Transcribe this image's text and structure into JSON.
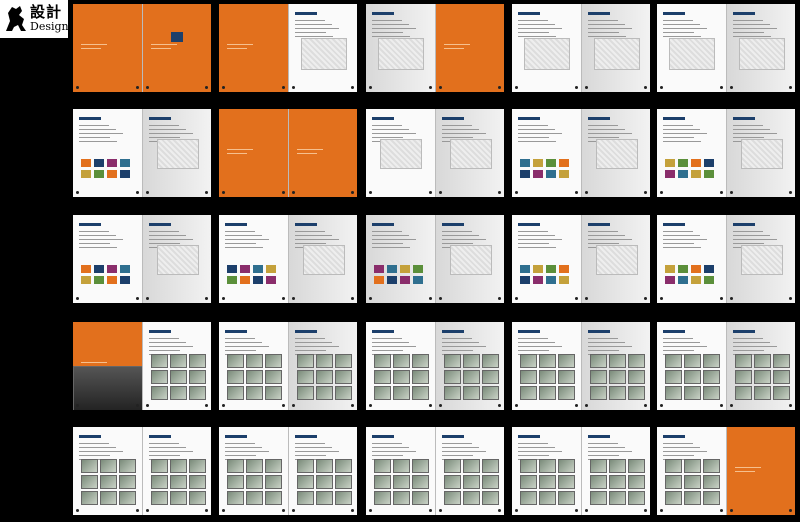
{
  "logo": {
    "text_cn": "設計",
    "text_en": "Design",
    "icon": "horse-icon"
  },
  "colors": {
    "orange": "#e2701d",
    "navy": "#1c3f6b",
    "background": "#000000"
  }
}
